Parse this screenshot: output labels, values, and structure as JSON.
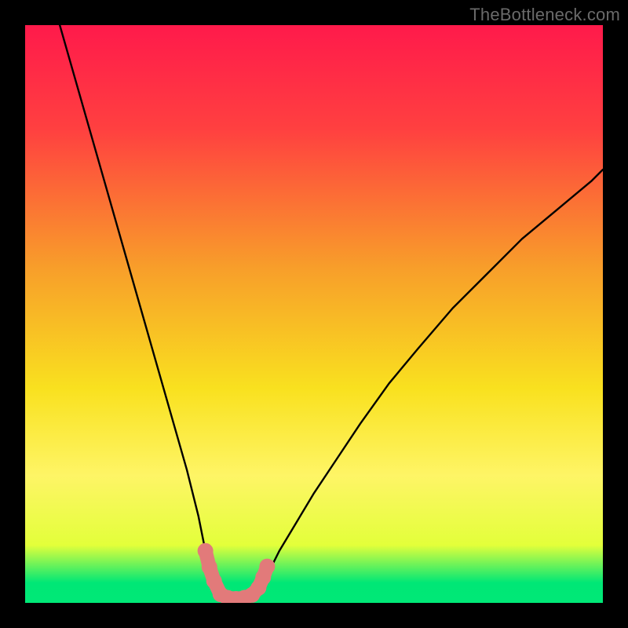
{
  "attribution": "TheBottleneck.com",
  "chart_data": {
    "type": "line",
    "title": "",
    "xlabel": "",
    "ylabel": "",
    "xlim": [
      0,
      100
    ],
    "ylim": [
      0,
      100
    ],
    "gradient_stops": [
      {
        "offset": 0.0,
        "color": "#ff1a4b"
      },
      {
        "offset": 0.18,
        "color": "#ff4040"
      },
      {
        "offset": 0.42,
        "color": "#f89e2a"
      },
      {
        "offset": 0.63,
        "color": "#f9e11f"
      },
      {
        "offset": 0.78,
        "color": "#fef566"
      },
      {
        "offset": 0.9,
        "color": "#e3ff3a"
      },
      {
        "offset": 0.965,
        "color": "#00e776"
      },
      {
        "offset": 1.0,
        "color": "#00e877"
      }
    ],
    "series": [
      {
        "name": "left-branch",
        "x": [
          6,
          8,
          10,
          12,
          14,
          16,
          18,
          20,
          22,
          24,
          26,
          28,
          30,
          31,
          32,
          33,
          33.8
        ],
        "y": [
          100,
          93,
          86,
          79,
          72,
          65,
          58,
          51,
          44,
          37,
          30,
          23,
          15,
          10,
          6,
          3,
          1.3
        ]
      },
      {
        "name": "right-branch",
        "x": [
          40.2,
          41,
          42,
          44,
          47,
          50,
          54,
          58,
          63,
          68,
          74,
          80,
          86,
          92,
          98,
          100
        ],
        "y": [
          1.3,
          3,
          5,
          9,
          14,
          19,
          25,
          31,
          38,
          44,
          51,
          57,
          63,
          68,
          73,
          75
        ]
      },
      {
        "name": "valley-floor",
        "x": [
          33.8,
          34.5,
          35.5,
          37,
          38.5,
          39.5,
          40.2
        ],
        "y": [
          1.3,
          0.8,
          0.6,
          0.55,
          0.6,
          0.8,
          1.3
        ]
      }
    ],
    "markers": {
      "name": "highlight-segment",
      "color": "#e27a7a",
      "points": [
        {
          "x": 31.2,
          "y": 9.0
        },
        {
          "x": 31.9,
          "y": 6.2
        },
        {
          "x": 32.7,
          "y": 3.8
        },
        {
          "x": 33.8,
          "y": 1.5
        },
        {
          "x": 35.0,
          "y": 0.9
        },
        {
          "x": 36.5,
          "y": 0.7
        },
        {
          "x": 38.0,
          "y": 0.9
        },
        {
          "x": 39.3,
          "y": 1.4
        },
        {
          "x": 40.4,
          "y": 2.6
        },
        {
          "x": 41.2,
          "y": 4.4
        },
        {
          "x": 41.9,
          "y": 6.3
        }
      ]
    }
  }
}
